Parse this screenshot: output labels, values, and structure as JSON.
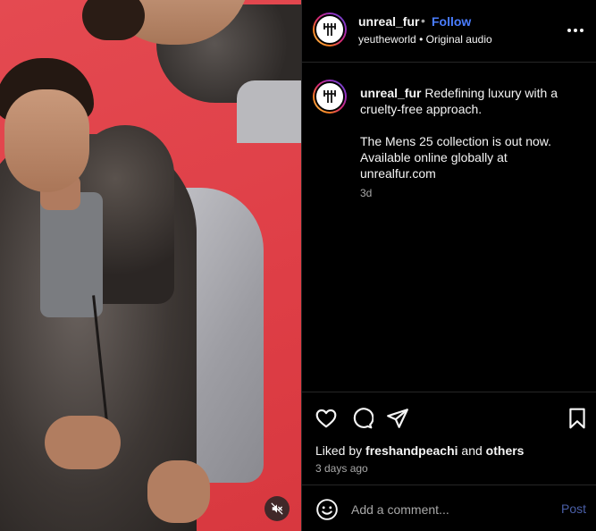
{
  "header": {
    "username": "unreal_fur",
    "separator": "•",
    "follow_label": "Follow",
    "audio_owner": "yeutheworld",
    "audio_separator": "•",
    "audio_label": "Original audio"
  },
  "caption": {
    "username": "unreal_fur",
    "line1": "Redefining luxury with a cruelty-free approach.",
    "line2": "The Mens 25 collection is out now.",
    "line3": "Available online globally at",
    "line4": "unrealfur.com",
    "time": "3d"
  },
  "likes": {
    "prefix": "Liked by",
    "user": "freshandpeachi",
    "conjunction": "and",
    "others": "others",
    "time_ago": "3 days ago"
  },
  "comment": {
    "placeholder": "Add a comment...",
    "post_label": "Post"
  },
  "icons": {
    "avatar": "unreal-fur-logo",
    "more": "more-horizontal-icon",
    "like": "heart-icon",
    "comment": "comment-icon",
    "share": "share-icon",
    "save": "bookmark-icon",
    "emoji": "emoji-icon",
    "mute": "speaker-muted-icon"
  },
  "colors": {
    "background": "#000000",
    "text": "#f5f5f5",
    "muted_text": "#a8a8a8",
    "follow": "#4a7dff",
    "post_button": "#4a5fa8",
    "media_background": "#e0434a"
  }
}
